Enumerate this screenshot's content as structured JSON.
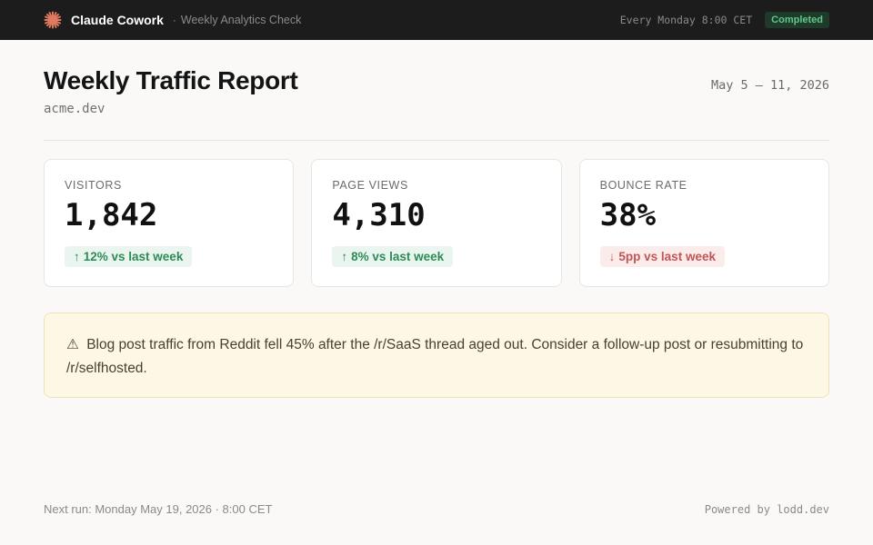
{
  "topbar": {
    "app_name": "Claude Cowork",
    "separator": "·",
    "task_name": "Weekly Analytics Check",
    "schedule": "Every Monday 8:00 CET",
    "status": "Completed",
    "logo_icon": "claude-spark-icon",
    "logo_color": "#e07a5f"
  },
  "report": {
    "title": "Weekly Traffic Report",
    "domain": "acme.dev",
    "date_range": "May 5 – 11, 2026"
  },
  "stats": [
    {
      "label": "Visitors",
      "value": "1,842",
      "delta_arrow": "↑",
      "delta": "12% vs last week",
      "trend": "up"
    },
    {
      "label": "Page Views",
      "value": "4,310",
      "delta_arrow": "↑",
      "delta": "8% vs last week",
      "trend": "up"
    },
    {
      "label": "Bounce Rate",
      "value": "38%",
      "delta_arrow": "↓",
      "delta": "5pp vs last week",
      "trend": "down"
    }
  ],
  "alert": {
    "icon": "⚠",
    "text": "Blog post traffic from Reddit fell 45% after the /r/SaaS thread aged out. Consider a follow-up post or resubmitting to /r/selfhosted."
  },
  "footer": {
    "next_run": "Next run: Monday May 19, 2026 · 8:00 CET",
    "powered_by": "Powered by lodd.dev"
  },
  "colors": {
    "topbar_bg": "#1c1c1c",
    "status_green": "#5fc98a",
    "positive": "#2e8b57",
    "negative": "#c25555",
    "alert_bg": "#fdf7e6"
  }
}
